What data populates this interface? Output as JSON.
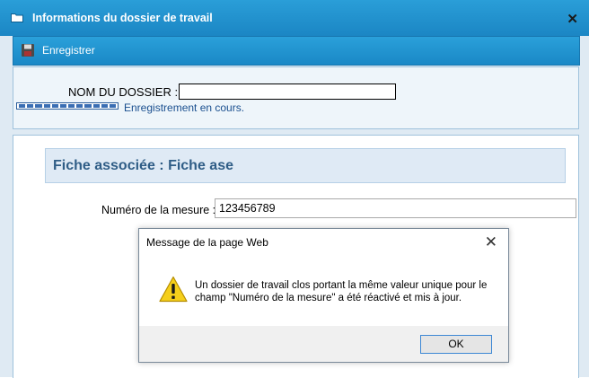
{
  "window": {
    "title": "Informations du dossier de travail",
    "close_icon": "close-icon",
    "folder_icon": "folder-icon"
  },
  "toolbar": {
    "save_label": "Enregistrer",
    "save_icon": "floppy-disk-icon"
  },
  "dossier": {
    "name_label": "NOM DU DOSSIER :",
    "name_value": "",
    "saving_text": "Enregistrement en cours."
  },
  "fiche": {
    "header": "Fiche associée : Fiche ase",
    "mesure_label": "Numéro de la mesure :",
    "mesure_value": "123456789"
  },
  "dialog": {
    "title": "Message de la page Web",
    "message": "Un dossier de travail clos portant la même valeur unique pour le champ \"Numéro de la mesure\" a été réactivé et mis à jour.",
    "ok_label": "OK",
    "icon": "warning-icon"
  },
  "colors": {
    "titlebar": "#1b86c4",
    "accent_text": "#2f5d86"
  }
}
